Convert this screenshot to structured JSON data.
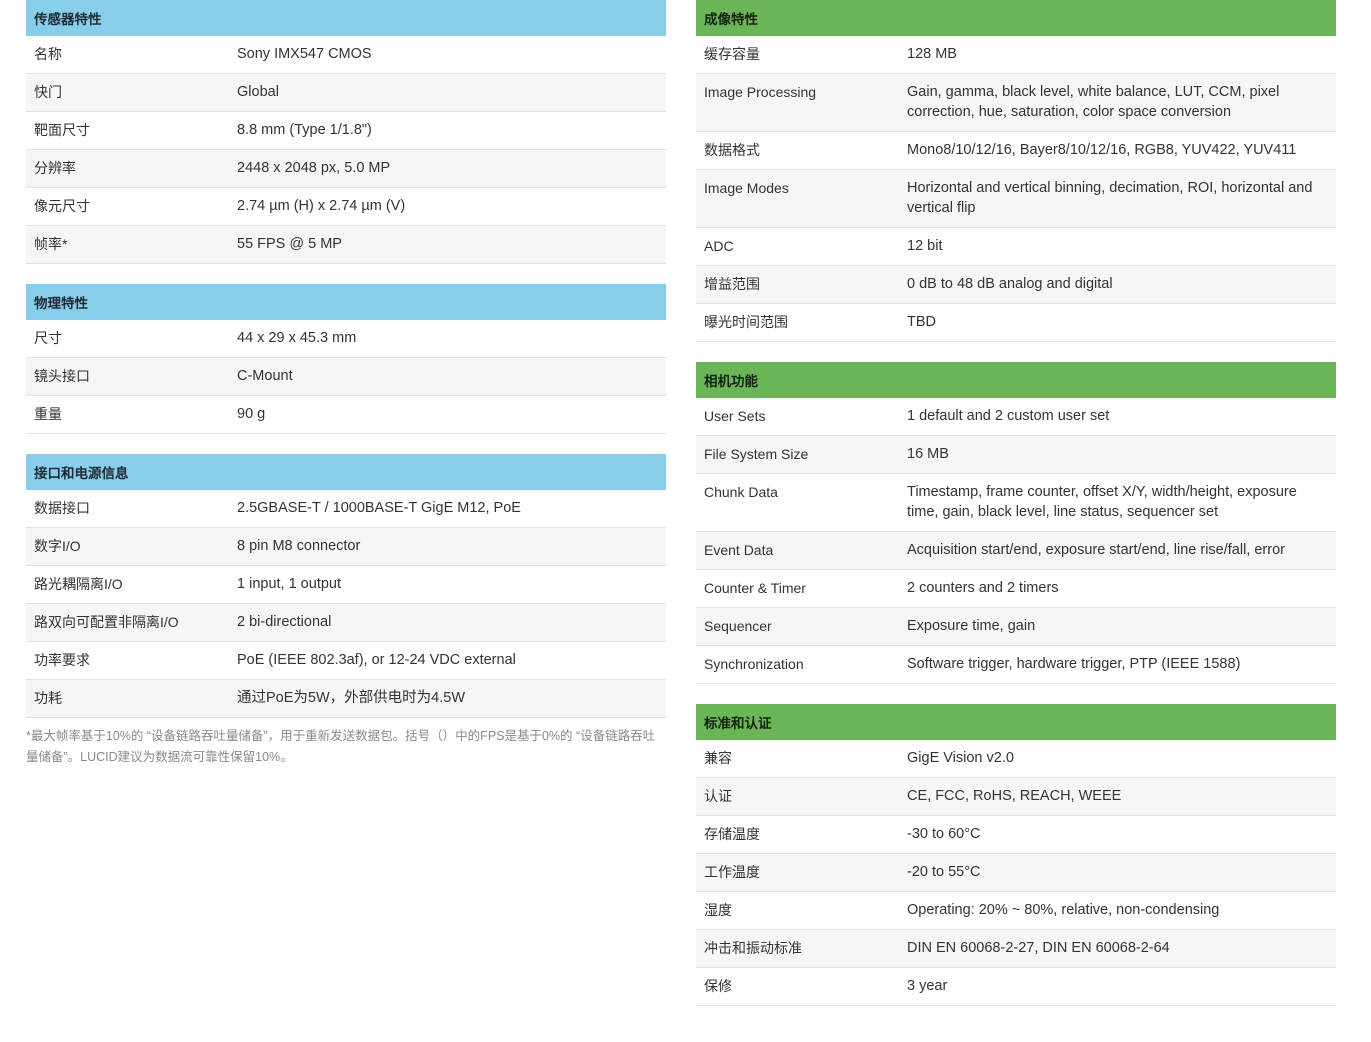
{
  "left": {
    "sections": [
      {
        "title": "传感器特性",
        "rows": [
          {
            "key": "名称",
            "value": "Sony IMX547 CMOS"
          },
          {
            "key": "快门",
            "value": "Global"
          },
          {
            "key": "靶面尺寸",
            "value": "8.8 mm (Type 1/1.8\")"
          },
          {
            "key": "分辨率",
            "value": "2448 x 2048 px, 5.0 MP"
          },
          {
            "key": "像元尺寸",
            "value": "2.74 µm (H) x 2.74 µm (V)"
          },
          {
            "key": "帧率*",
            "value": "55 FPS @ 5 MP"
          }
        ]
      },
      {
        "title": "物理特性",
        "rows": [
          {
            "key": "尺寸",
            "value": "44 x 29 x 45.3 mm"
          },
          {
            "key": "镜头接口",
            "value": "C-Mount"
          },
          {
            "key": "重量",
            "value": "90 g"
          }
        ]
      },
      {
        "title": "接口和电源信息",
        "rows": [
          {
            "key": "数据接口",
            "value": "2.5GBASE-T / 1000BASE-T GigE M12, PoE"
          },
          {
            "key": "数字I/O",
            "value": "8 pin M8 connector"
          },
          {
            "key": "路光耦隔离I/O",
            "value": "1 input, 1 output"
          },
          {
            "key": "路双向可配置非隔离I/O",
            "value": "2 bi-directional"
          },
          {
            "key": "功率要求",
            "value": "PoE (IEEE 802.3af), or 12-24 VDC external"
          },
          {
            "key": "功耗",
            "value": "通过PoE为5W，外部供电时为4.5W"
          }
        ]
      }
    ],
    "footnote": "*最大帧率基于10%的 “设备链路吞吐量储备”，用于重新发送数据包。括号（）中的FPS是基于0%的 “设备链路吞吐量储备”。LUCID建议为数据流可靠性保留10%。"
  },
  "right": {
    "sections": [
      {
        "title": "成像特性",
        "rows": [
          {
            "key": "缓存容量",
            "value": "128 MB"
          },
          {
            "key": "Image Processing",
            "value": "Gain, gamma, black level, white balance, LUT, CCM, pixel correction, hue, saturation, color space conversion"
          },
          {
            "key": "数据格式",
            "value": "Mono8/10/12/16, Bayer8/10/12/16, RGB8, YUV422, YUV411"
          },
          {
            "key": "Image Modes",
            "value": "Horizontal and vertical binning, decimation, ROI, horizontal and vertical flip"
          },
          {
            "key": "ADC",
            "value": "12 bit"
          },
          {
            "key": "增益范围",
            "value": "0 dB to 48 dB analog and digital"
          },
          {
            "key": "曝光时间范围",
            "value": "TBD"
          }
        ]
      },
      {
        "title": "相机功能",
        "rows": [
          {
            "key": "User Sets",
            "value": "1 default and 2 custom user set"
          },
          {
            "key": "File System Size",
            "value": "16 MB"
          },
          {
            "key": "Chunk Data",
            "value": "Timestamp, frame counter, offset X/Y, width/height, exposure time, gain, black level, line status, sequencer set"
          },
          {
            "key": "Event Data",
            "value": "Acquisition start/end, exposure start/end, line rise/fall, error"
          },
          {
            "key": "Counter & Timer",
            "value": "2 counters and 2 timers"
          },
          {
            "key": "Sequencer",
            "value": "Exposure time, gain"
          },
          {
            "key": "Synchronization",
            "value": "Software trigger, hardware trigger, PTP (IEEE 1588)"
          }
        ]
      },
      {
        "title": "标准和认证",
        "rows": [
          {
            "key": "兼容",
            "value": "GigE Vision v2.0"
          },
          {
            "key": "认证",
            "value": "CE, FCC, RoHS, REACH, WEEE"
          },
          {
            "key": "存储温度",
            "value": "-30 to 60°C"
          },
          {
            "key": "工作温度",
            "value": "-20 to 55°C"
          },
          {
            "key": "湿度",
            "value": "Operating: 20% ~ 80%, relative, non-condensing"
          },
          {
            "key": "冲击和振动标准",
            "value": "DIN EN 60068-2-27, DIN EN 60068-2-64"
          },
          {
            "key": "保修",
            "value": "3 year"
          }
        ]
      }
    ]
  },
  "colors": {
    "header_left": "#87ceeb",
    "header_right": "#6ab556"
  }
}
